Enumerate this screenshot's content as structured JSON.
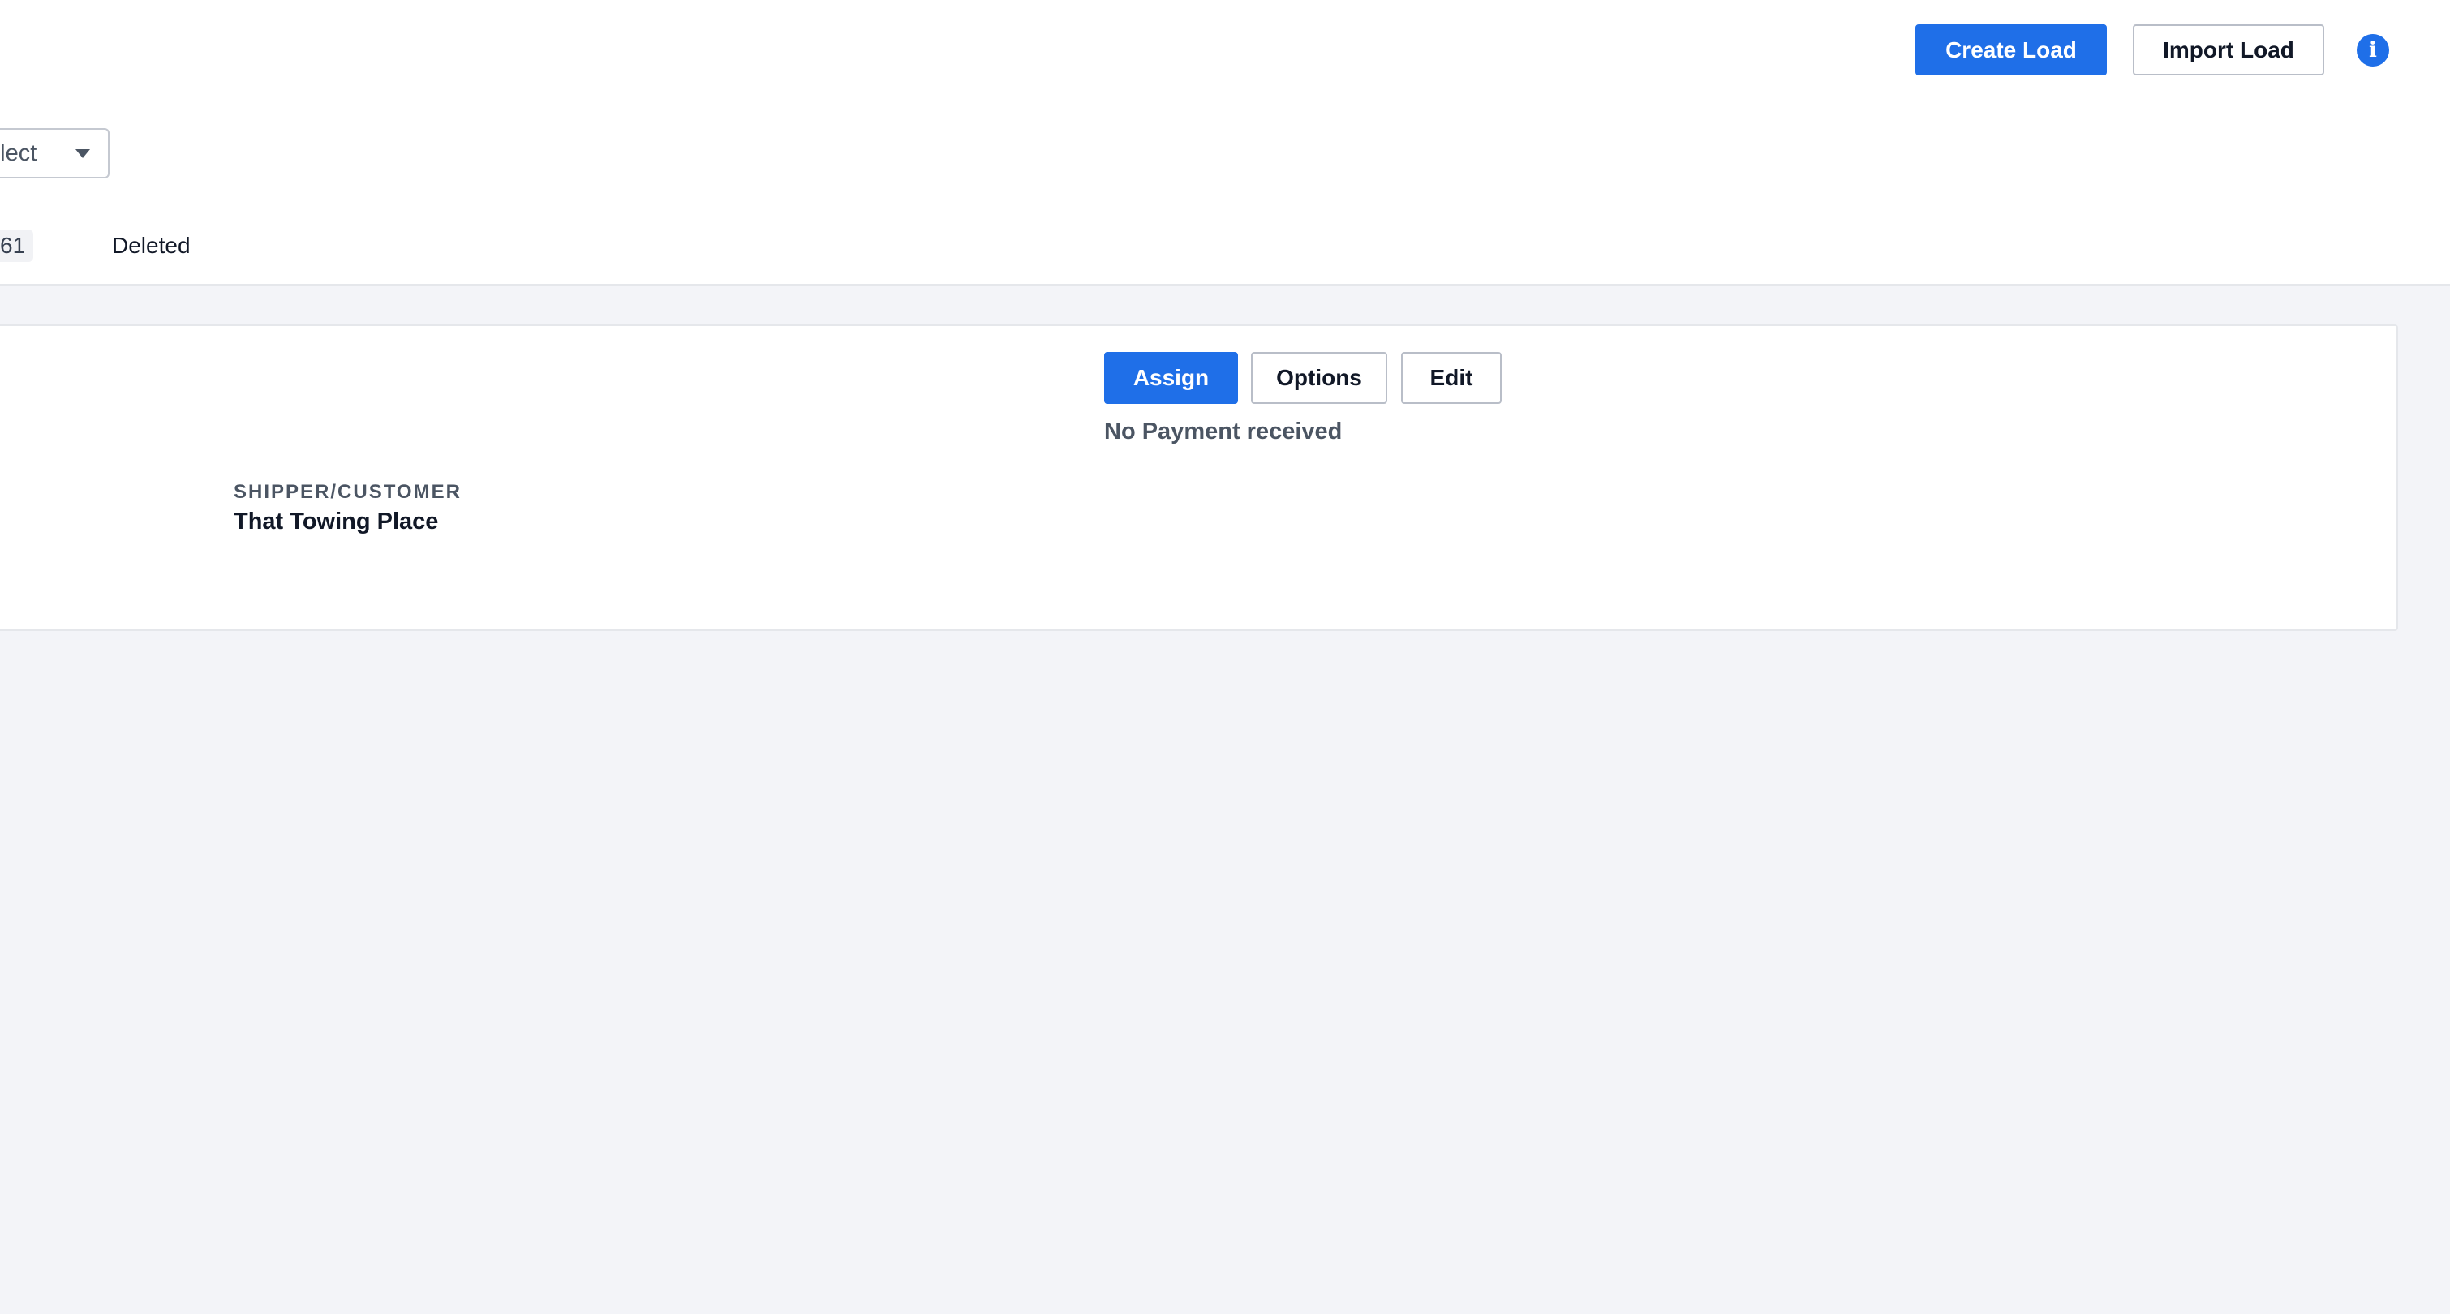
{
  "header": {
    "create_load_label": "Create Load",
    "import_load_label": "Import Load",
    "info_icon_glyph": "i",
    "info_icon": "info-icon"
  },
  "filters": {
    "select_value": "elect"
  },
  "tabs": {
    "count_badge": "61",
    "deleted_label": "Deleted"
  },
  "load_card": {
    "assign_label": "Assign",
    "options_label": "Options",
    "edit_label": "Edit",
    "payment_status": "No Payment received",
    "shipper_label": "SHIPPER/CUSTOMER",
    "shipper_value": "That Towing Place"
  },
  "colors": {
    "primary": "#1f6fe8",
    "page_background": "#f3f4f8",
    "border": "#e5e7eb"
  }
}
